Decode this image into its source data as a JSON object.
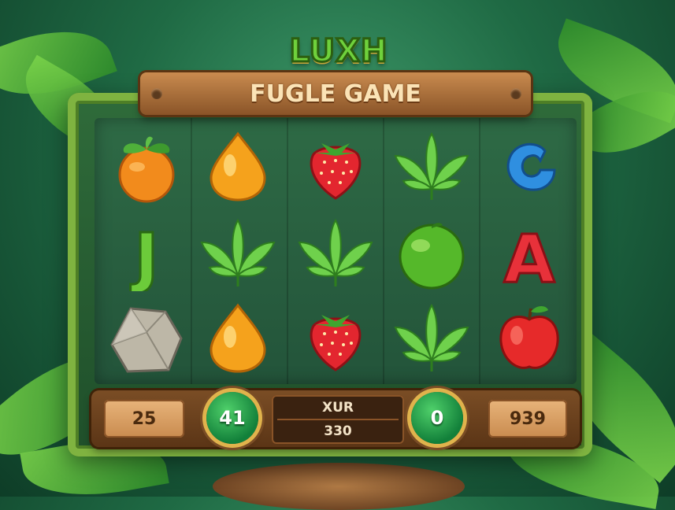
{
  "logo": {
    "top_text": "LUXH"
  },
  "sign": {
    "title": "FUGLE GAME"
  },
  "reels": {
    "symbols": [
      [
        "orange",
        "orange-drop",
        "strawberry",
        "leaf",
        "letter-c"
      ],
      [
        "letter-j",
        "leaf",
        "leaf",
        "green-apple",
        "letter-a"
      ],
      [
        "stone",
        "orange-drop",
        "strawberry",
        "leaf",
        "red-apple"
      ]
    ],
    "letters": {
      "j": "J",
      "a": "A"
    }
  },
  "panel": {
    "left_value": "25",
    "left_circle": "41",
    "center_label": "XUR",
    "center_value": "330",
    "right_circle": "0",
    "right_value": "939"
  },
  "colors": {
    "jungle": "#1f6a44",
    "wood": "#8a5428",
    "button_green": "#12803a",
    "gold": "#e0b34c"
  }
}
